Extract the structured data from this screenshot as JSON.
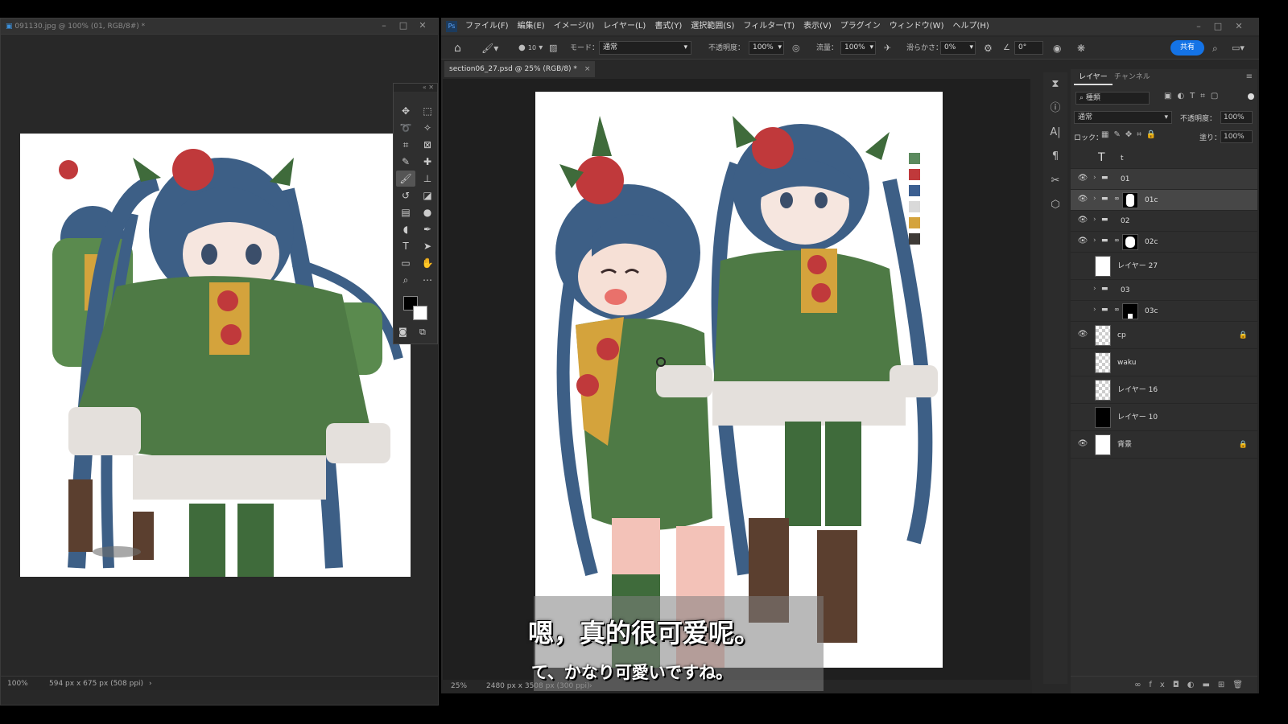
{
  "left_window": {
    "title": "091130.jpg @ 100% (01, RGB/8#) *",
    "zoom": "100%",
    "doc_info": "594 px x 675 px (508 ppi)"
  },
  "right_window": {
    "menus": [
      "ファイル(F)",
      "編集(E)",
      "イメージ(I)",
      "レイヤー(L)",
      "書式(Y)",
      "選択範囲(S)",
      "フィルター(T)",
      "表示(V)",
      "プラグイン",
      "ウィンドウ(W)",
      "ヘルプ(H)"
    ],
    "options": {
      "brush_size": "10",
      "mode_label": "モード：",
      "mode_value": "通常",
      "opacity_label": "不透明度：",
      "opacity_value": "100%",
      "flow_label": "流量：",
      "flow_value": "100%",
      "smoothing_label": "滑らかさ：",
      "smoothing_value": "0%",
      "angle_value": "0°",
      "share_label": "共有"
    },
    "doc_tab": "section06_27.psd @ 25% (RGB/8) *",
    "zoom": "25%",
    "doc_info": "2480 px x 3508 px (300 ppi)"
  },
  "layers_panel": {
    "tabs": [
      "レイヤー",
      "チャンネル"
    ],
    "search_placeholder": "種類",
    "blend_mode": "通常",
    "opacity_label": "不透明度：",
    "opacity_value": "100%",
    "lock_label": "ロック：",
    "fill_label": "塗り：",
    "fill_value": "100%",
    "layers": [
      {
        "name": "t",
        "kind": "text",
        "visible": false
      },
      {
        "name": "01",
        "kind": "group",
        "visible": true
      },
      {
        "name": "01c",
        "kind": "group-mask",
        "visible": true
      },
      {
        "name": "02",
        "kind": "group",
        "visible": true
      },
      {
        "name": "02c",
        "kind": "group-mask",
        "visible": true
      },
      {
        "name": "レイヤー 27",
        "kind": "white",
        "visible": false
      },
      {
        "name": "03",
        "kind": "group",
        "visible": false
      },
      {
        "name": "03c",
        "kind": "group-mask-black",
        "visible": false
      },
      {
        "name": "cp",
        "kind": "transparent",
        "visible": true,
        "locked": true
      },
      {
        "name": "waku",
        "kind": "transparent",
        "visible": false
      },
      {
        "name": "レイヤー 16",
        "kind": "transparent",
        "visible": false
      },
      {
        "name": "レイヤー 10",
        "kind": "black",
        "visible": false
      },
      {
        "name": "背景",
        "kind": "white",
        "visible": true,
        "locked": true
      }
    ]
  },
  "palette_colors": [
    "#5b8a5e",
    "#c0393b",
    "#3b5f91",
    "#d9d9d9",
    "#d4a33c",
    "#3e3a36"
  ],
  "subtitle": {
    "chinese": "嗯，真的很可爱呢。",
    "japanese": "て、かなり可愛いですね。"
  }
}
